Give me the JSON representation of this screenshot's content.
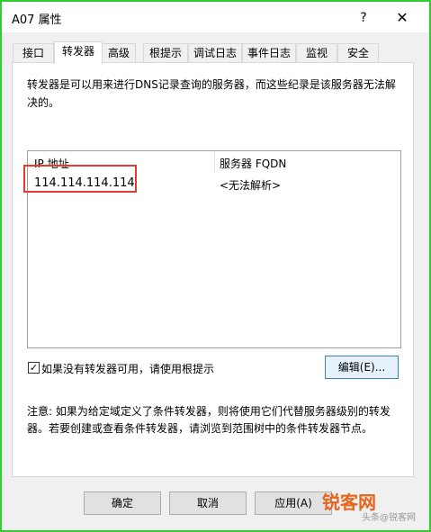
{
  "window": {
    "title": "A07 属性",
    "help": "?",
    "close": "✕"
  },
  "tabs": [
    {
      "label": "接口",
      "active": false
    },
    {
      "label": "转发器",
      "active": true
    },
    {
      "label": "高级",
      "active": false
    },
    {
      "label": "根提示",
      "active": false
    },
    {
      "label": "调试日志",
      "active": false
    },
    {
      "label": "事件日志",
      "active": false
    },
    {
      "label": "监视",
      "active": false
    },
    {
      "label": "安全",
      "active": false
    }
  ],
  "description": "转发器是可以用来进行DNS记录查询的服务器，而这些纪录是该服务器无法解决的。",
  "list": {
    "columns": [
      "IP 地址",
      "服务器 FQDN"
    ],
    "rows": [
      {
        "ip": "114.114.114.114",
        "fqdn": "<无法解析>"
      }
    ]
  },
  "use_root_hints": {
    "label": "如果没有转发器可用，请使用根提示",
    "checked": true
  },
  "edit_button": "编辑(E)...",
  "note": "注意: 如果为给定域定义了条件转发器，则将使用它们代替服务器级别的转发器。若要创建或查看条件转发器，请浏览到范围树中的条件转发器节点。",
  "buttons": {
    "ok": "确定",
    "cancel": "取消",
    "apply": "应用(A)"
  },
  "watermark": {
    "text": "锐客网",
    "sub": "头条@锐客网"
  },
  "colors": {
    "border": "#33cc33",
    "highlight": "#e03c31",
    "watermark": "#e8641c"
  }
}
